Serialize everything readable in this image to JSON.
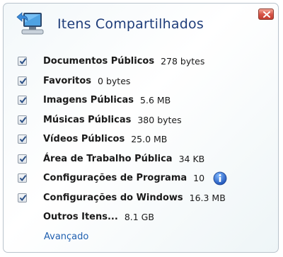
{
  "header": {
    "title": "Itens Compartilhados"
  },
  "items": [
    {
      "label": "Documentos Públicos",
      "size": "278 bytes",
      "checked": true
    },
    {
      "label": "Favoritos",
      "size": "0 bytes",
      "checked": true
    },
    {
      "label": "Imagens Públicas",
      "size": "5.6 MB",
      "checked": true
    },
    {
      "label": "Músicas Públicas",
      "size": "380 bytes",
      "checked": true
    },
    {
      "label": "Vídeos Públicos",
      "size": "25.0 MB",
      "checked": true
    },
    {
      "label": "Área de Trabalho Pública",
      "size": "34 KB",
      "checked": true
    },
    {
      "label": "Configurações de Programa",
      "size": "10",
      "checked": true,
      "icon": "info-icon"
    },
    {
      "label": "Configurações do Windows",
      "size": "16.3 MB",
      "checked": true
    },
    {
      "label": "Outros Itens...",
      "size": "8.1 GB",
      "checked": false
    }
  ],
  "footer": {
    "advanced_link": "Avançado"
  },
  "colors": {
    "title": "#1f3d7a",
    "link": "#2060b0",
    "close": "#c23d30"
  }
}
